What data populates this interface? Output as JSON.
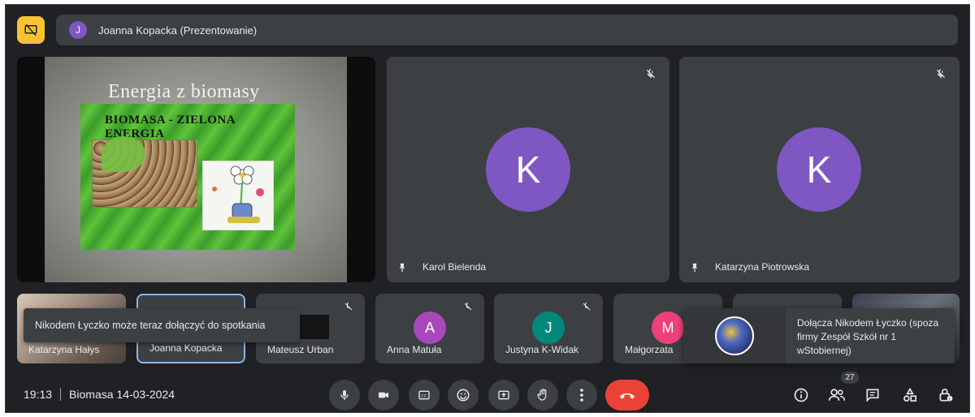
{
  "presenter": {
    "initial": "J",
    "label": "Joanna Kopacka (Prezentowanie)"
  },
  "slide": {
    "title": "Energia z biomasy",
    "heading": "BIOMASA - ZIELONA ENERGIA"
  },
  "main_tiles": [
    {
      "initial": "K",
      "name": "Karol Bielenda",
      "avatar_color": "#7e57c2"
    },
    {
      "initial": "K",
      "name": "Katarzyna Piotrowska",
      "avatar_color": "#7e57c2"
    }
  ],
  "filmstrip": [
    {
      "name": "Katarzyna Hałys",
      "type": "photo"
    },
    {
      "name": "Joanna Kopacka",
      "type": "selected"
    },
    {
      "name": "Mateusz Urban",
      "type": "photo-dark"
    },
    {
      "name": "Anna Matuła",
      "initial": "A",
      "avatar_color": "#ab47bc"
    },
    {
      "name": "Justyna K-Widak",
      "initial": "J",
      "avatar_color": "#00897b"
    },
    {
      "name": "Małgorzata",
      "initial": "M",
      "avatar_color": "#ec407a"
    }
  ],
  "toast_left": "Nikodem Łyczko może teraz dołączyć do spotkania",
  "toast_right": "Dołącza Nikodem Łyczko (spoza firmy Zespół Szkół nr 1 wStobiernej)",
  "bottom": {
    "time": "19:13",
    "meeting_name": "Biomasa 14-03-2024",
    "participant_count": "27"
  },
  "colors": {
    "background": "#202124",
    "tile": "#3c4043",
    "present_accent": "#f9c232",
    "end_call": "#ea4335",
    "selected_border": "#8ab4f8"
  }
}
